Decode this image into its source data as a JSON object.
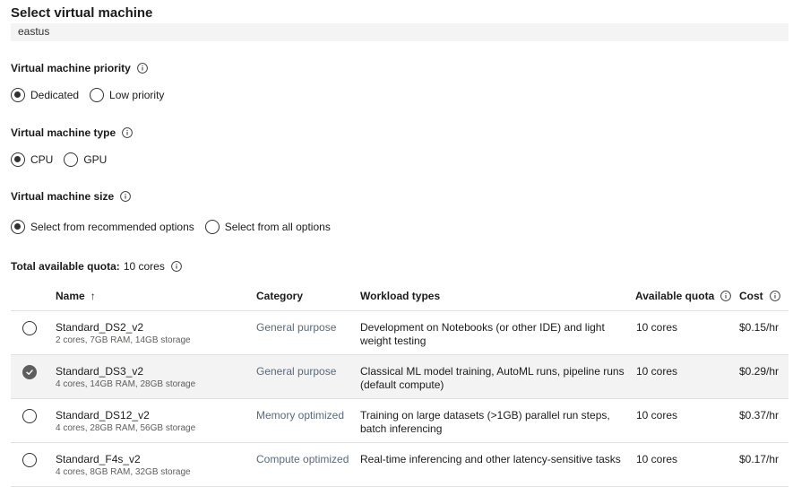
{
  "title": "Select virtual machine",
  "region": "eastus",
  "priority": {
    "label": "Virtual machine priority",
    "options": [
      {
        "label": "Dedicated",
        "checked": true
      },
      {
        "label": "Low priority",
        "checked": false
      }
    ]
  },
  "type": {
    "label": "Virtual machine type",
    "options": [
      {
        "label": "CPU",
        "checked": true
      },
      {
        "label": "GPU",
        "checked": false
      }
    ]
  },
  "size": {
    "label": "Virtual machine size",
    "options": [
      {
        "label": "Select from recommended options",
        "checked": true
      },
      {
        "label": "Select from all options",
        "checked": false
      }
    ]
  },
  "quota": {
    "label": "Total available quota:",
    "value": "10 cores"
  },
  "table": {
    "headers": {
      "name": "Name",
      "sort_indicator": "↑",
      "category": "Category",
      "workload": "Workload types",
      "quota": "Available quota",
      "cost": "Cost"
    },
    "rows": [
      {
        "name": "Standard_DS2_v2",
        "specs": "2 cores, 7GB RAM, 14GB storage",
        "category": "General purpose",
        "workload": "Development on Notebooks (or other IDE) and light weight testing",
        "quota": "10 cores",
        "cost": "$0.15/hr",
        "selected": false
      },
      {
        "name": "Standard_DS3_v2",
        "specs": "4 cores, 14GB RAM, 28GB storage",
        "category": "General purpose",
        "workload": "Classical ML model training, AutoML runs, pipeline runs (default compute)",
        "quota": "10 cores",
        "cost": "$0.29/hr",
        "selected": true
      },
      {
        "name": "Standard_DS12_v2",
        "specs": "4 cores, 28GB RAM, 56GB storage",
        "category": "Memory optimized",
        "workload": "Training on large datasets (>1GB) parallel run steps, batch inferencing",
        "quota": "10 cores",
        "cost": "$0.37/hr",
        "selected": false
      },
      {
        "name": "Standard_F4s_v2",
        "specs": "4 cores, 8GB RAM, 32GB storage",
        "category": "Compute optimized",
        "workload": "Real-time inferencing and other latency-sensitive tasks",
        "quota": "10 cores",
        "cost": "$0.17/hr",
        "selected": false
      }
    ]
  },
  "icons": {
    "info": "info-icon",
    "sort": "sort-ascending-icon",
    "check": "checkmark-icon"
  },
  "colors": {
    "selected_row": "#f3f3f3",
    "checked_radio": "#605e5c",
    "category_text": "#5a6a7a"
  }
}
